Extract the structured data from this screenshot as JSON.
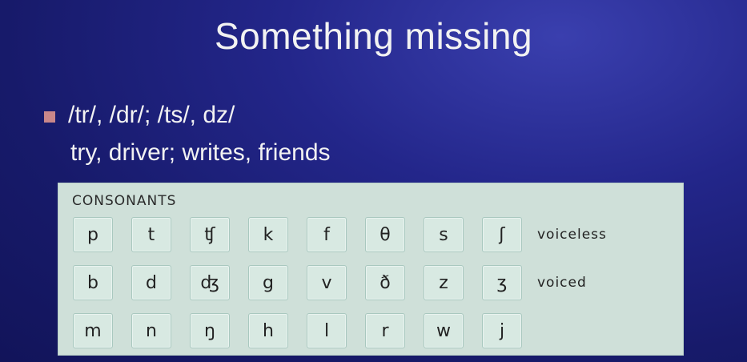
{
  "slide": {
    "title": "Something missing",
    "bullet": "/tr/, /dr/; /ts/, dz/",
    "subline": "try, driver; writes, friends"
  },
  "consonant_chart": {
    "heading": "CONSONANTS",
    "rows": [
      {
        "symbols": [
          "p",
          "t",
          "ʧ",
          "k",
          "f",
          "θ",
          "s",
          "ʃ"
        ],
        "label": "voiceless"
      },
      {
        "symbols": [
          "b",
          "d",
          "ʤ",
          "g",
          "v",
          "ð",
          "z",
          "ʒ"
        ],
        "label": "voiced"
      },
      {
        "symbols": [
          "m",
          "n",
          "ŋ",
          "h",
          "l",
          "r",
          "w",
          "j"
        ],
        "label": ""
      }
    ]
  }
}
